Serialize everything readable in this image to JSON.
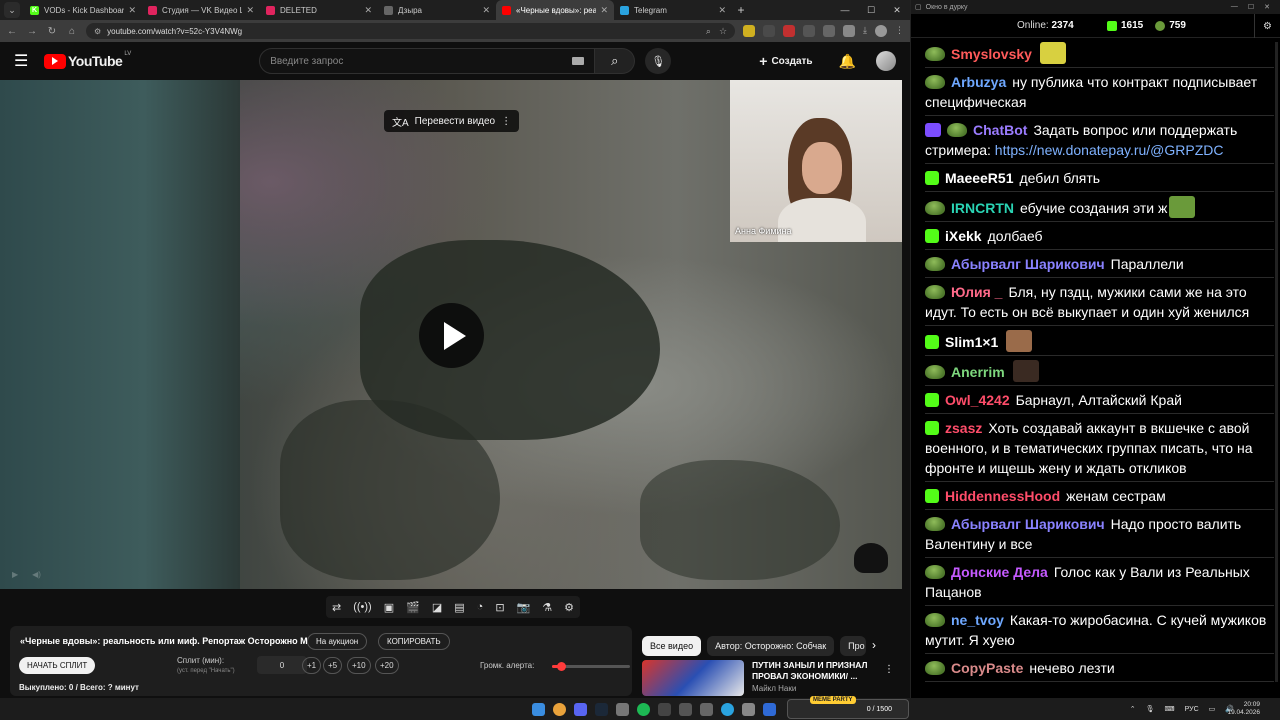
{
  "browser": {
    "tabs": [
      {
        "title": "VODs - Kick Dashboard",
        "color": "#53fc18",
        "glyph": "K",
        "active": false
      },
      {
        "title": "Студия — VK Видео Live",
        "color": "#e0245e",
        "glyph": "",
        "active": false
      },
      {
        "title": "DELETED",
        "color": "#e0245e",
        "glyph": "",
        "active": false
      },
      {
        "title": "Дзыра",
        "color": "#666666",
        "glyph": "",
        "active": false
      },
      {
        "title": "«Черные вдовы»: реальность",
        "color": "#ff0000",
        "glyph": "",
        "active": true
      },
      {
        "title": "Telegram",
        "color": "#2aa3df",
        "glyph": "",
        "active": false
      }
    ],
    "url": "youtube.com/watch?v=52c-Y3V4NWg"
  },
  "youtube": {
    "logo_text": "YouTube",
    "region": "LV",
    "search_placeholder": "Введите запрос",
    "create_label": "Создать",
    "translate_label": "Перевести видео",
    "pip_name": "Анна Фимина"
  },
  "panel": {
    "video_title": "«Черные вдовы»: реальность или миф. Репортаж Осторожно Media",
    "auction_label": "На аукцион",
    "copy_label": "КОПИРОВАТЬ",
    "start_split_label": "НАЧАТЬ СПЛИТ",
    "split_label": "Сплит (мин):",
    "split_hint": "(уст. перед \"Начать\")",
    "split_value": "0",
    "increments": [
      "+1",
      "+5",
      "+10",
      "+20"
    ],
    "volume_label": "Громк. алерта:",
    "volume_level": 0.12,
    "bought_label": "Выкуплено: 0 / Всего: ? минут"
  },
  "chips": [
    "Все видео",
    "Автор: Осторожно: Собчак",
    "Про"
  ],
  "recommendation": {
    "title": "ПУТИН ЗАНЫЛ И ПРИЗНАЛ ПРОВАЛ ЭКОНОМИКИ/ ...",
    "channel": "Майкл Наки"
  },
  "chat": {
    "window_title": "Окно в дурку",
    "online_label": "Online:",
    "online_count": "2374",
    "kick_count": "1615",
    "pepe_count": "759",
    "messages": [
      {
        "badge": "pepe",
        "nick": "Smyslovsky",
        "color": "#ff5a5a",
        "text": "",
        "emote": "#d8d040"
      },
      {
        "badge": "pepe",
        "nick": "Arbuzya",
        "color": "#6fa8ff",
        "text": "ну публика что контракт подписывает специфическая",
        "emote": ""
      },
      {
        "badge": "bot",
        "nick": "ChatBot",
        "color": "#9b7cff",
        "text": "Задать вопрос или поддержать стримера: ",
        "link": "https://new.donatepay.ru/@GRPZDC",
        "emote": ""
      },
      {
        "badge": "kick",
        "nick": "MaeeeR51",
        "color": "#ffffff",
        "text": "дебил блять",
        "emote": ""
      },
      {
        "badge": "pepe",
        "nick": "IRNCRTN",
        "color": "#2ad4b4",
        "text": "ебучие создания эти ж",
        "emote": "#6a9a3a"
      },
      {
        "badge": "kick",
        "nick": "iXekk",
        "color": "#ffffff",
        "text": "долбаеб",
        "emote": ""
      },
      {
        "badge": "pepe",
        "nick": "Абырвалг Шарикович",
        "color": "#8a82ff",
        "text": "Параллели",
        "emote": ""
      },
      {
        "badge": "pepe",
        "nick": "Юлия _",
        "color": "#ff6a8a",
        "text": "Бля, ну пздц, мужики сами же на это идут. То есть он всё выкупает и один хуй женился",
        "emote": ""
      },
      {
        "badge": "kick",
        "nick": "Slim1×1",
        "color": "#ffffff",
        "text": "",
        "emote": "#9a6b4a"
      },
      {
        "badge": "pepe",
        "nick": "Anerrim",
        "color": "#7ed87e",
        "text": "",
        "emote": "#3a2a22"
      },
      {
        "badge": "kick",
        "nick": "Owl_4242",
        "color": "#ff4d6a",
        "text": "Барнаул, Алтайский Край",
        "emote": ""
      },
      {
        "badge": "kick",
        "nick": "zsasz",
        "color": "#ff4d6a",
        "text": "Хоть создавай аккаунт в вкшечке с авой военного, и в тематических группах писать, что на фронте и ищешь жену и ждать откликов",
        "emote": ""
      },
      {
        "badge": "kick",
        "nick": "HiddennessHood",
        "color": "#ff4d6a",
        "text": "женам сестрам",
        "emote": ""
      },
      {
        "badge": "pepe",
        "nick": "Абырвалг Шарикович",
        "color": "#8a82ff",
        "text": "Надо просто валить Валентину и все",
        "emote": ""
      },
      {
        "badge": "pepe",
        "nick": "Донские Дела",
        "color": "#c55aff",
        "text": "Голос как у Вали из Реальных Пацанов",
        "emote": ""
      },
      {
        "badge": "pepe",
        "nick": "ne_tvoy",
        "color": "#6fa8ff",
        "text": "Какая-то жиробасина. С кучей мужиков мутит. Я хуею",
        "emote": ""
      },
      {
        "badge": "pepe",
        "nick": "CopyPaste",
        "color": "#d98a8a",
        "text": "нечево лезти",
        "emote": ""
      }
    ]
  },
  "taskbar": {
    "meme_tag": "MEME PARTY",
    "meme_value": "0 / 1500",
    "lang": "РУС",
    "time": "20:09",
    "date": "19.04.2026"
  }
}
